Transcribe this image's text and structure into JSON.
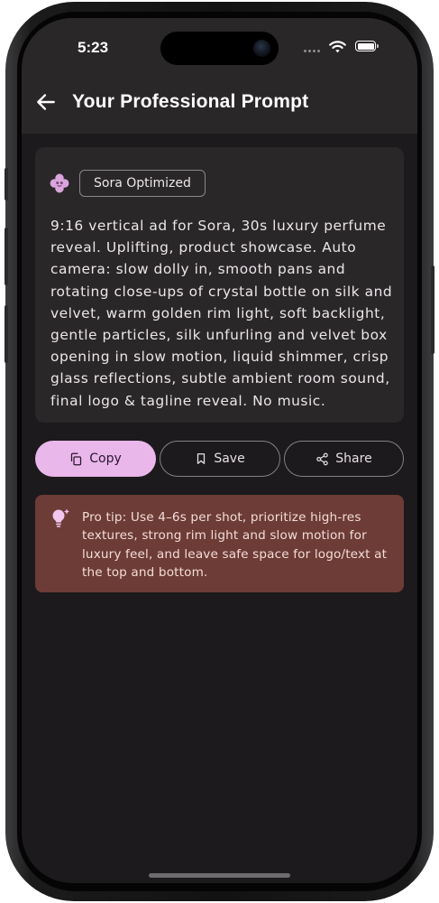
{
  "status_bar": {
    "time": "5:23"
  },
  "header": {
    "title": "Your Professional Prompt",
    "back_icon": "arrow-left-icon"
  },
  "prompt_card": {
    "badge": "Sora Optimized",
    "badge_icon": "flower-icon",
    "text": "9:16 vertical ad for Sora, 30s luxury perfume reveal. Uplifting, product showcase. Auto camera: slow dolly in, smooth pans and rotating close-ups of crystal bottle on silk and velvet, warm golden rim light, soft backlight, gentle particles, silk unfurling and velvet box opening in slow motion, liquid shimmer, crisp glass reflections, subtle ambient room sound, final logo & tagline reveal. No music."
  },
  "actions": {
    "copy": "Copy",
    "save": "Save",
    "share": "Share"
  },
  "tip": {
    "icon": "lightbulb-icon",
    "text": "Pro tip: Use 4–6s per shot, prioritize high-res textures, strong rim light and slow motion for luxury feel, and leave safe space for logo/text at the top and bottom."
  },
  "colors": {
    "accent": "#e9b7ea",
    "tip_background": "#6d3c37",
    "card_background": "#2a2729",
    "screen_background": "#1c1a1c"
  }
}
